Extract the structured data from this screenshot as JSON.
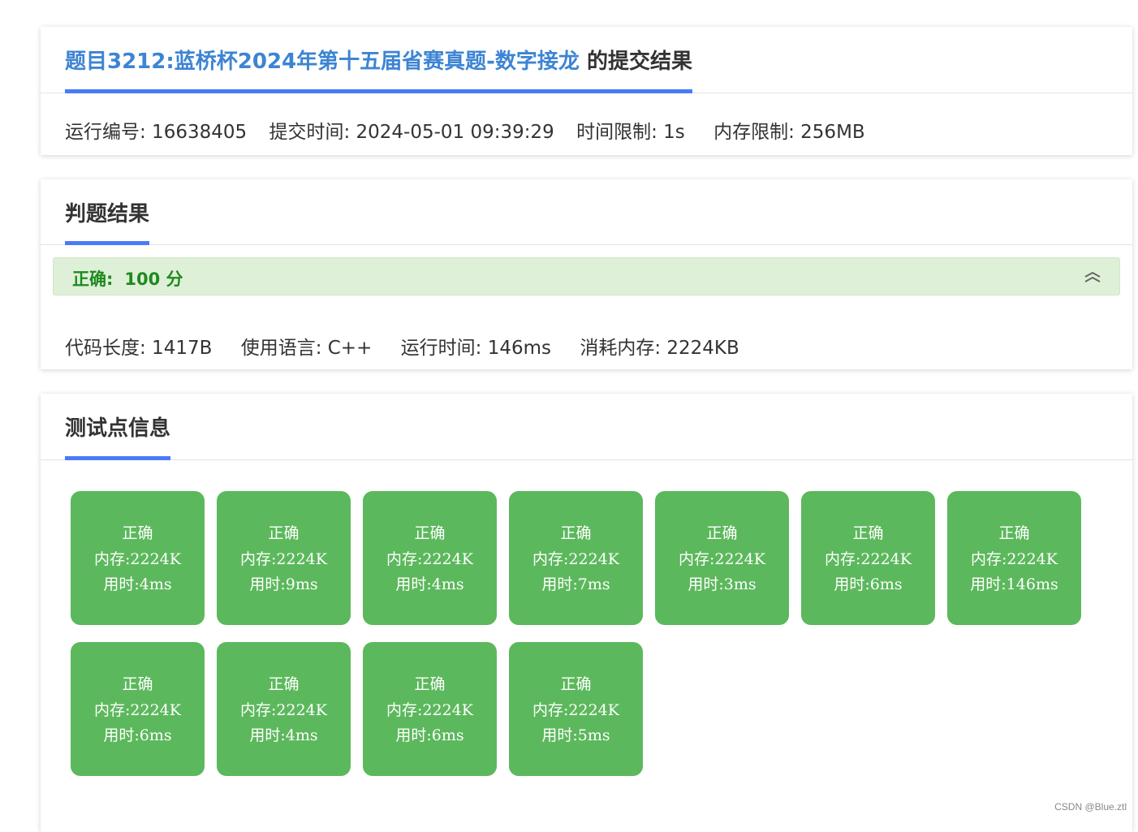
{
  "submission": {
    "title_link": "题目3212:蓝桥杯2024年第十五届省赛真题-数字接龙",
    "title_suffix": " 的提交结果",
    "run_id": "运行编号: 16638405",
    "submit_time": "提交时间: 2024-05-01 09:39:29",
    "time_limit": "时间限制: 1s",
    "memory_limit": "内存限制: 256MB"
  },
  "judge": {
    "heading": "判题结果",
    "status": "正确:",
    "score": "100 分",
    "collapse_icon": "double-chevron-up-icon",
    "code_length": "代码长度: 1417B",
    "language": "使用语言: C++",
    "run_time": "运行时间: 146ms",
    "memory_used": "消耗内存: 2224KB",
    "accent_color": "#4a7bf7",
    "status_bg": "#dff0d8",
    "status_color": "#1e8a1e"
  },
  "testcases": {
    "heading": "测试点信息",
    "tile_color": "#5cb85c",
    "items": [
      {
        "status": "正确",
        "memory": "内存:2224K",
        "time": "用时:4ms"
      },
      {
        "status": "正确",
        "memory": "内存:2224K",
        "time": "用时:9ms"
      },
      {
        "status": "正确",
        "memory": "内存:2224K",
        "time": "用时:4ms"
      },
      {
        "status": "正确",
        "memory": "内存:2224K",
        "time": "用时:7ms"
      },
      {
        "status": "正确",
        "memory": "内存:2224K",
        "time": "用时:3ms"
      },
      {
        "status": "正确",
        "memory": "内存:2224K",
        "time": "用时:6ms"
      },
      {
        "status": "正确",
        "memory": "内存:2224K",
        "time": "用时:146ms"
      },
      {
        "status": "正确",
        "memory": "内存:2224K",
        "time": "用时:6ms"
      },
      {
        "status": "正确",
        "memory": "内存:2224K",
        "time": "用时:4ms"
      },
      {
        "status": "正确",
        "memory": "内存:2224K",
        "time": "用时:6ms"
      },
      {
        "status": "正确",
        "memory": "内存:2224K",
        "time": "用时:5ms"
      }
    ]
  },
  "watermark": "CSDN @Blue.ztl"
}
